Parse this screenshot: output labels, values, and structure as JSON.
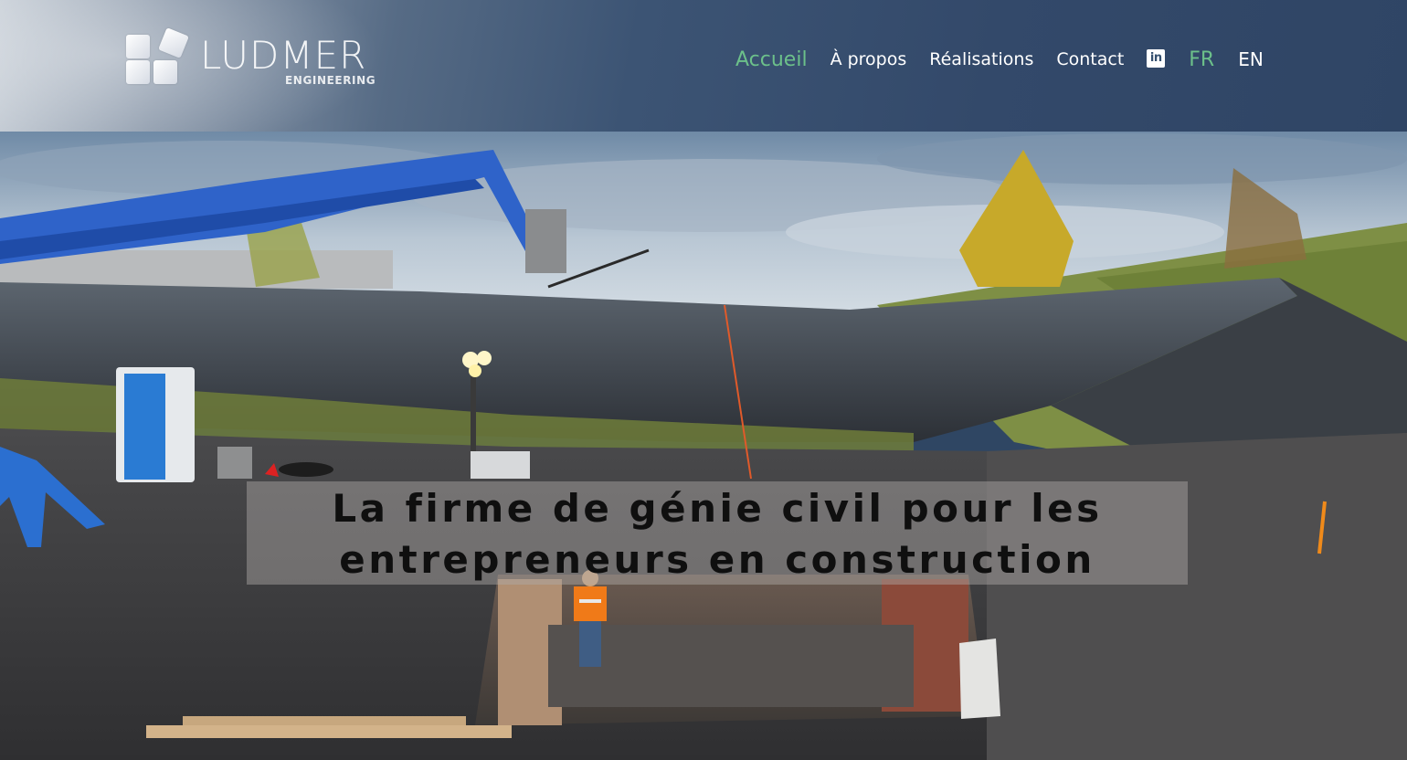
{
  "header": {
    "logo": {
      "name": "LUDMER",
      "subtitle": "ENGINEERING"
    },
    "nav": [
      {
        "label": "Accueil",
        "active": true
      },
      {
        "label": "À propos",
        "active": false
      },
      {
        "label": "Réalisations",
        "active": false
      },
      {
        "label": "Contact",
        "active": false
      }
    ],
    "social": {
      "icon": "linkedin-icon",
      "label": "in"
    },
    "languages": [
      {
        "label": "FR",
        "active": true
      },
      {
        "label": "EN",
        "active": false
      }
    ]
  },
  "hero": {
    "tagline_line1": "La firme de génie civil pour les",
    "tagline_line2": "entrepreneurs en construction",
    "image": "construction-excavation-site"
  },
  "colors": {
    "header_bg": "#33496a",
    "active_link": "#6cc08a",
    "link": "#ffffff",
    "tagline_text": "#0f0f0f"
  }
}
